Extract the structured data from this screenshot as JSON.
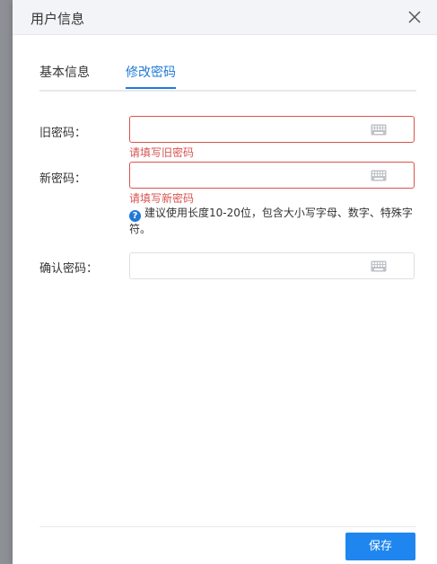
{
  "dialog": {
    "title": "用户信息",
    "close_icon": "close-icon"
  },
  "tabs": [
    {
      "label": "基本信息",
      "active": false
    },
    {
      "label": "修改密码",
      "active": true
    }
  ],
  "form": {
    "old_password": {
      "label": "旧密码：",
      "value": "",
      "error": "请填写旧密码"
    },
    "new_password": {
      "label": "新密码：",
      "value": "",
      "error": "请填写新密码"
    },
    "hint": "建议使用长度10-20位，包含大小写字母、数字、特殊字符。",
    "confirm_password": {
      "label": "确认密码：",
      "value": ""
    }
  },
  "footer": {
    "save_label": "保存"
  },
  "colors": {
    "accent": "#1f7ad8",
    "error": "#d9534f",
    "save_button": "#1f86f0"
  }
}
